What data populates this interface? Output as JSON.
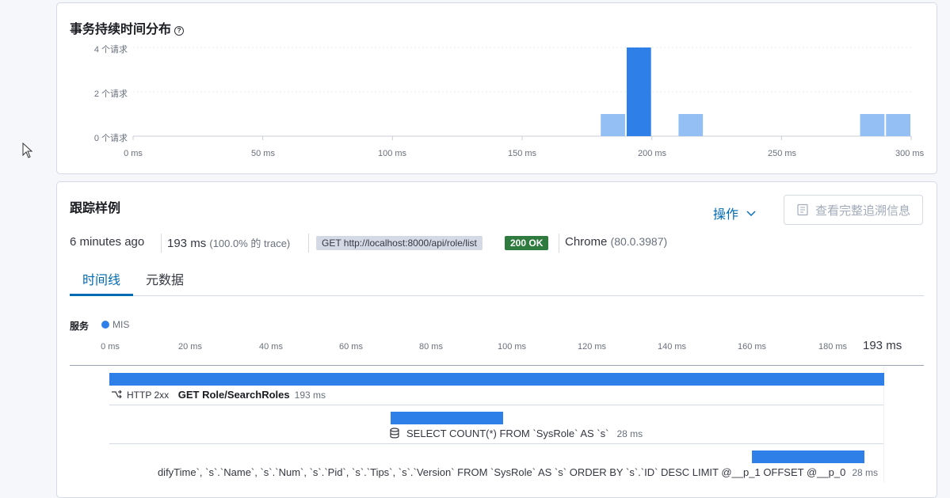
{
  "histogram": {
    "title": "事务持续时间分布",
    "help_glyph": "?",
    "y_ticks": [
      "4 个请求",
      "2 个请求",
      "0 个请求"
    ],
    "x_ticks": [
      "0 ms",
      "50 ms",
      "100 ms",
      "150 ms",
      "200 ms",
      "250 ms",
      "300 ms"
    ]
  },
  "chart_data": {
    "type": "bar",
    "title": "事务持续时间分布",
    "xlabel": "",
    "ylabel": "",
    "x_unit": "ms",
    "xlim": [
      0,
      300
    ],
    "ylim": [
      0,
      4
    ],
    "bins": [
      {
        "x0": 180,
        "x1": 190,
        "value": 1,
        "selected": false
      },
      {
        "x0": 190,
        "x1": 200,
        "value": 4,
        "selected": true
      },
      {
        "x0": 210,
        "x1": 220,
        "value": 1,
        "selected": false
      },
      {
        "x0": 280,
        "x1": 290,
        "value": 1,
        "selected": false
      },
      {
        "x0": 290,
        "x1": 300,
        "value": 1,
        "selected": false
      }
    ],
    "colors": {
      "selected": "#2f7fe8",
      "normal": "#94bff5"
    }
  },
  "trace": {
    "title": "跟踪样例",
    "actions_label": "操作",
    "view_full_trace_label": "查看完整追溯信息",
    "age": "6 minutes ago",
    "duration": "193 ms",
    "duration_detail": "(100.0% 的 trace)",
    "request": "GET http://localhost:8000/api/role/list",
    "status": "200 OK",
    "browser": "Chrome",
    "browser_version": "(80.0.3987)",
    "tabs": [
      "时间线",
      "元数据"
    ],
    "active_tab": 0
  },
  "timeline": {
    "services_label": "服务",
    "service_name": "MIS",
    "service_color": "#2f7fe8",
    "ticks": [
      "0 ms",
      "20 ms",
      "40 ms",
      "60 ms",
      "80 ms",
      "100 ms",
      "120 ms",
      "140 ms",
      "160 ms",
      "180 ms"
    ],
    "total": "193 ms",
    "spans": [
      {
        "start_ms": 0,
        "duration_ms": 193,
        "type": "HTTP 2xx",
        "name": "GET Role/SearchRoles",
        "duration_label": "193 ms"
      },
      {
        "start_ms": 70,
        "duration_ms": 28,
        "type": "",
        "name": "SELECT COUNT(*) FROM `SysRole` AS `s`",
        "duration_label": "28 ms"
      },
      {
        "start_ms": 160,
        "duration_ms": 28,
        "type": "",
        "name": "difyTime`, `s`.`Name`, `s`.`Num`, `s`.`Pid`, `s`.`Tips`, `s`.`Version` FROM `SysRole` AS `s` ORDER BY `s`.`ID` DESC LIMIT @__p_1 OFFSET @__p_0",
        "duration_label": "28 ms"
      }
    ]
  }
}
